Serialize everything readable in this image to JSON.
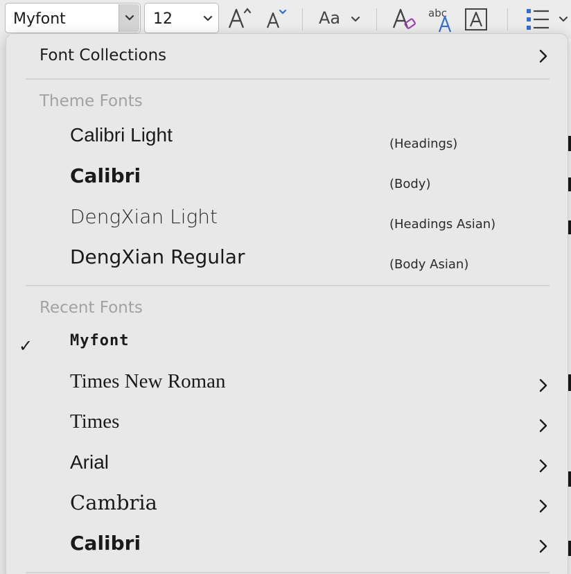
{
  "toolbar": {
    "font_name": "Myfont",
    "font_size": "12",
    "case_label": "Aa",
    "effects_label": "abc",
    "grow_font_icon": "grow-font-icon",
    "shrink_font_icon": "shrink-font-icon",
    "clear_format_icon": "clear-formatting-icon",
    "text_effects_icon": "text-effects-icon",
    "char_border_icon": "character-border-icon",
    "bullets_icon": "bullet-list-icon"
  },
  "menu": {
    "collections_label": "Font Collections",
    "theme_header": "Theme Fonts",
    "theme_fonts": [
      {
        "name": "Calibri Light",
        "tag": "(Headings)"
      },
      {
        "name": "Calibri",
        "tag": "(Body)"
      },
      {
        "name": "DengXian Light",
        "tag": "(Headings Asian)"
      },
      {
        "name": "DengXian Regular",
        "tag": "(Body Asian)"
      }
    ],
    "recent_header": "Recent Fonts",
    "recent_fonts": [
      {
        "name": "Myfont",
        "checked": true,
        "submenu": false
      },
      {
        "name": "Times New Roman",
        "checked": false,
        "submenu": true
      },
      {
        "name": "Times",
        "checked": false,
        "submenu": true
      },
      {
        "name": "Arial",
        "checked": false,
        "submenu": true
      },
      {
        "name": "Cambria",
        "checked": false,
        "submenu": true
      },
      {
        "name": "Calibri",
        "checked": false,
        "submenu": true
      }
    ],
    "check_mark": "✓"
  },
  "colors": {
    "accent_purple": "#9b3fb5",
    "accent_blue": "#2f6fd6",
    "menu_bg": "#e8e8e8",
    "header_gray": "#a2a2a2"
  }
}
